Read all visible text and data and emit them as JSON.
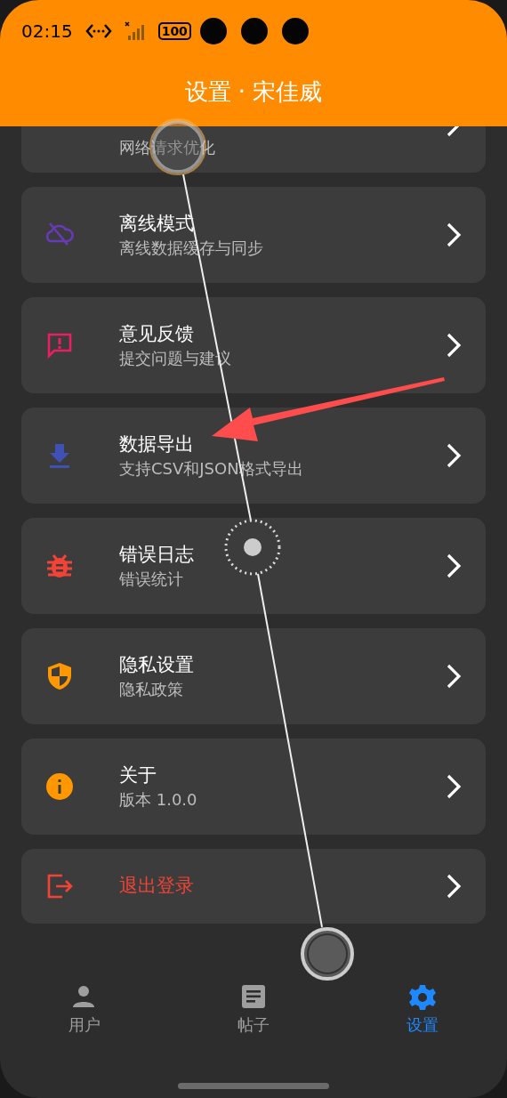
{
  "status_bar": {
    "time": "02:15",
    "battery": "100"
  },
  "header": {
    "title": "设置 · 宋佳威"
  },
  "settings": [
    {
      "kind": "normal",
      "subtitle": "网络请求优化"
    },
    {
      "kind": "normal",
      "color": "#673ab7",
      "title": "离线模式",
      "subtitle": "离线数据缓存与同步"
    },
    {
      "kind": "normal",
      "color": "#e91e63",
      "title": "意见反馈",
      "subtitle": "提交问题与建议"
    },
    {
      "kind": "normal",
      "color": "#3f51b5",
      "title": "数据导出",
      "subtitle": "支持CSV和JSON格式导出"
    },
    {
      "kind": "normal",
      "color": "#f44336",
      "title": "错误日志",
      "subtitle": "错误统计"
    },
    {
      "kind": "normal",
      "color": "#ff9800",
      "title": "隐私设置",
      "subtitle": "隐私政策"
    },
    {
      "kind": "normal",
      "color": "#ff9800",
      "title": "关于",
      "subtitle": "版本 1.0.0"
    },
    {
      "kind": "danger",
      "color": "#f44336",
      "title": "退出登录"
    }
  ],
  "bottom_nav": [
    {
      "label": "用户",
      "selected": false
    },
    {
      "label": "帖子",
      "selected": false
    },
    {
      "label": "设置",
      "selected": true
    }
  ],
  "annotations": [
    {
      "kind": "swipe-trace"
    },
    {
      "kind": "arrow"
    }
  ]
}
